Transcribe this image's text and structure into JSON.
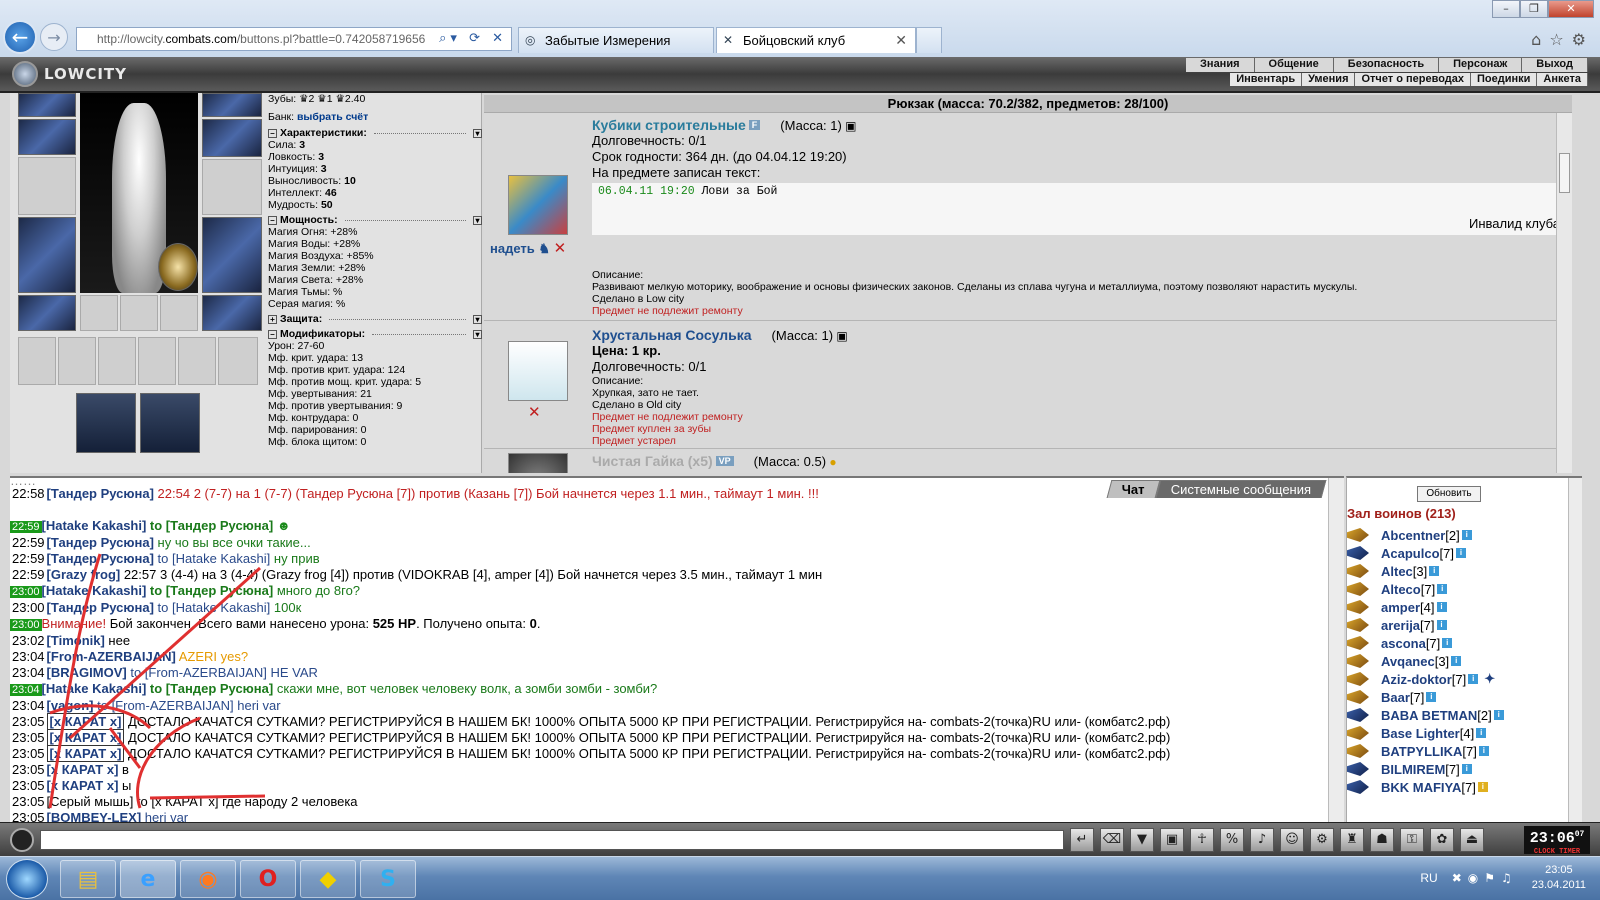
{
  "browser": {
    "url_prefix": "http://lowcity.",
    "url_domain": "combats.com",
    "url_suffix": "/buttons.pl?battle=0.742058719656",
    "tabs": [
      {
        "label": "Забытые Измерения"
      },
      {
        "label": "Бойцовский клуб"
      }
    ]
  },
  "game": {
    "logo": "LOWCITY",
    "menu_top": [
      "Знания",
      "Общение",
      "Безопасность",
      "Персонаж",
      "Выход"
    ],
    "menu_bottom": [
      "Инвентарь",
      "Умения",
      "Отчет о переводах",
      "Поединки",
      "Анкета"
    ]
  },
  "stats": {
    "teeth": "Зубы: ♛2 ♛1 ♛2.40",
    "bank_label": "Банк:",
    "bank_link": "выбрать счёт",
    "char_header": "Характеристики:",
    "chars": [
      {
        "k": "Сила: ",
        "v": "3"
      },
      {
        "k": "Ловкость: ",
        "v": "3"
      },
      {
        "k": "Интуиция: ",
        "v": "3"
      },
      {
        "k": "Выносливость: ",
        "v": "10"
      },
      {
        "k": "Интеллект: ",
        "v": "46"
      },
      {
        "k": "Мудрость: ",
        "v": "50"
      }
    ],
    "power_header": "Мощность:",
    "powers": [
      "Магия Огня: +28%",
      "Магия Воды: +28%",
      "Магия Воздуха: +85%",
      "Магия Земли: +28%",
      "Магия Света: +28%",
      "Магия Тьмы: %",
      "Серая магия: %"
    ],
    "defense_header": "Защита:",
    "mod_header": "Модификаторы:",
    "mods": [
      "Урон: 27-60",
      "Мф. крит. удара: 13",
      "Мф. против крит. удара: 124",
      "Мф. против мощ. крит. удара: 5",
      "Мф. увертывания: 21",
      "Мф. против увертывания: 9",
      "Мф. контрудара: 0",
      "Мф. парирования: 0",
      "Мф. блока щитом: 0"
    ]
  },
  "backpack": {
    "title": "Рюкзак (масса: 70.2/382, предметов: 28/100)",
    "wear_label": "надеть",
    "item1": {
      "name": "Кубики строительные",
      "badge": "F",
      "mass": "(Масса: 1)",
      "durability": "Долговечность: 0/1",
      "expiry": "Срок годности: 364 дн. (до 04.04.12 19:20)",
      "note_label": "На предмете записан текст:",
      "note_time": "06.04.11 19:20",
      "note_text": " Лови за Бой",
      "note_sig": "Инвалид клуба",
      "desc_label": "Описание:",
      "desc": "Развивают мелкую моторику, воображение и основы физических законов. Сделаны из сплава чугуна и металлиума, поэтому позволяют нарастить мускулы.",
      "made": "Сделано в Low city",
      "warn": "Предмет не подлежит ремонту"
    },
    "item2": {
      "name": "Хрустальная Сосулька",
      "mass": "(Масса: 1)",
      "price": "Цена: 1 кр.",
      "durability": "Долговечность: 0/1",
      "desc_label": "Описание:",
      "desc": "Хрупкая, зато не тает.",
      "made": "Сделано в Old city",
      "warn1": "Предмет не подлежит ремонту",
      "warn2": "Предмет куплен за зубы",
      "warn3": "Предмет устарел"
    },
    "item3": {
      "name": "Чистая Гайка (x5)",
      "badge": "VP",
      "mass": "(Масса: 0.5)"
    }
  },
  "chat": {
    "tab_chat": "Чат",
    "tab_system": "Системные сообщения",
    "m1": {
      "t": "22:58",
      "nick": "[Тандер Русюна]",
      "text": " 22:54 2 (7-7) на 1 (7-7) (Тандер Русюна [7]) против (Казань [7]) Бой начнется через 1.1 мин., таймаут 1 мин. !!!"
    },
    "m2": {
      "t": "22:59",
      "nick": "[Hatake Kakashi]",
      "to": " to [Тандер Русюна]"
    },
    "m3": {
      "t": "22:59",
      "nick": "[Тандер Русюна]",
      "text": " ну чо вы все очки такие..."
    },
    "m4": {
      "t": "22:59",
      "nick": "[Тандер Русюна]",
      "to": " to [Hatake Kakashi]",
      "text": " ну прив"
    },
    "m5": {
      "t": "22:59",
      "nick": "[Grazy frog]",
      "text": " 22:57 3 (4-4) на 3 (4-4) (Grazy frog [4]) против (VIDOKRAB [4], amper [4]) Бой начнется через 3.5 мин., таймаут 1 мин"
    },
    "m6": {
      "t": "23:00",
      "nick": "[Hatake Kakashi]",
      "to": " to [Тандер Русюна]",
      "text": " много до 8го?"
    },
    "m7": {
      "t": "23:00",
      "nick": "[Тандер Русюна]",
      "to": " to [Hatake Kakashi]",
      "text": " 100к"
    },
    "m8": {
      "t": "23:00",
      "warn": "Внимание!",
      "text": " Бой закончен. Всего вами нанесено урона: ",
      "dmg": "525 HP",
      "text2": ". Получено опыта: ",
      "exp": "0",
      "end": "."
    },
    "m9": {
      "t": "23:02",
      "nick": "[Timonik]",
      "text": " нее"
    },
    "m10": {
      "t": "23:04",
      "nick": "[From-AZERBAIJAN]",
      "text": " AZERI yes?"
    },
    "m11": {
      "t": "23:04",
      "nick": "[BRAGIMOV]",
      "to": " to [From-AZERBAIJAN]",
      "text": " HE VAR"
    },
    "m12": {
      "t": "23:04",
      "nick": "[Hatake Kakashi]",
      "to": " to [Тандер Русюна]",
      "text": " скажи мне, вот человек человеку волк, а зомби зомби - зомби?"
    },
    "m13": {
      "t": "23:04",
      "nick": "[vagon]",
      "to": " to [From-AZERBAIJAN]",
      "text": " heri var"
    },
    "spam": " ДОСТАЛО КАЧАТСЯ СУТКАМИ? РЕГИСТРИРУЙСЯ В НАШЕМ БК! 1000% ОПЫТА 5000 КР ПРИ РЕГИСТРАЦИИ. Регистрируйся на- combats-2(точка)RU или- (комбатс2.рф)",
    "karat": "[x КАРАТ x]",
    "spam_times": [
      "23:05",
      "23:05",
      "23:05"
    ],
    "m17": {
      "t": "23:05",
      "text": " в"
    },
    "m18": {
      "t": "23:05",
      "text": " ы"
    },
    "m19": {
      "t": "23:05",
      "nick": "[Серый мышь]",
      "to": " to [x КАРАТ x]",
      "text": " где народу 2 человека"
    },
    "m20": {
      "t": "23:05",
      "nick": "[BOMBEY-LEX]",
      "text": " heri var"
    }
  },
  "players": {
    "refresh": "Обновить",
    "hall": "Зал воинов (213)",
    "list": [
      {
        "n": "Abcentner",
        "l": "[2]"
      },
      {
        "n": "Acapulco",
        "l": "[7]"
      },
      {
        "n": "Altec",
        "l": "[3]"
      },
      {
        "n": "Alteco",
        "l": "[7]"
      },
      {
        "n": "amper",
        "l": "[4]"
      },
      {
        "n": "arerija",
        "l": "[7]"
      },
      {
        "n": "ascona",
        "l": "[7]"
      },
      {
        "n": "Avqanec",
        "l": "[3]"
      },
      {
        "n": "Aziz-doktor",
        "l": "[7]"
      },
      {
        "n": "Baar",
        "l": "[7]"
      },
      {
        "n": "BABA BETMAN",
        "l": "[2]"
      },
      {
        "n": "Base Lighter",
        "l": "[4]"
      },
      {
        "n": "BATPYLLIKA",
        "l": "[7]"
      },
      {
        "n": "BILMIREM",
        "l": "[7]"
      },
      {
        "n": "BKK MAFIYA",
        "l": "[7]"
      }
    ]
  },
  "clock": {
    "time": "23:06",
    "sec": "07",
    "label": "CLOCK TIMER"
  },
  "taskbar": {
    "lang": "RU",
    "time": "23:05",
    "date": "23.04.2011"
  }
}
